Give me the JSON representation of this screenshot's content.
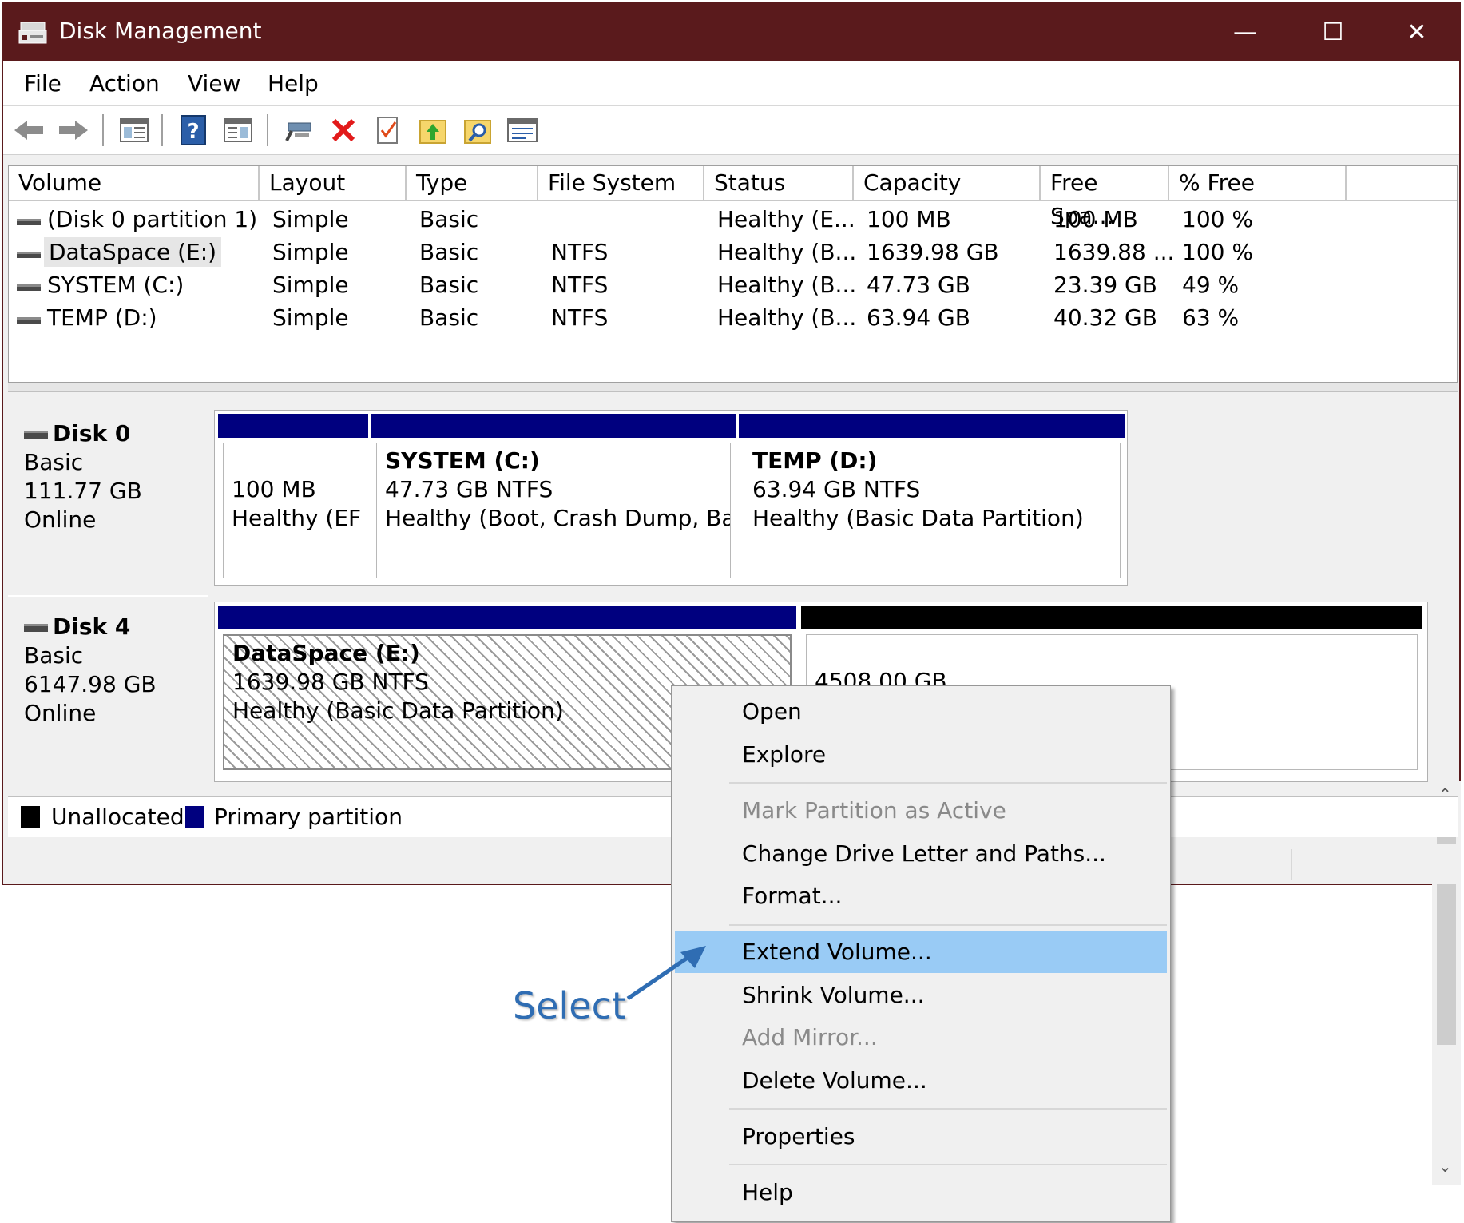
{
  "window": {
    "title": "Disk Management",
    "controls": {
      "minimize": "—",
      "maximize": "☐",
      "close": "✕"
    }
  },
  "menubar": [
    "File",
    "Action",
    "View",
    "Help"
  ],
  "toolbar": [
    "back-icon",
    "forward-icon",
    "console-tree-icon",
    "help-icon",
    "action-pane-icon",
    "connect-icon",
    "delete-icon",
    "check-icon",
    "up-folder-icon",
    "search-folder-icon",
    "properties-icon"
  ],
  "columns": [
    "Volume",
    "Layout",
    "Type",
    "File System",
    "Status",
    "Capacity",
    "Free Spa...",
    "% Free"
  ],
  "volumes": [
    {
      "volume": "(Disk 0 partition 1)",
      "layout": "Simple",
      "type": "Basic",
      "fs": "",
      "status": "Healthy (E...",
      "capacity": "100 MB",
      "free": "100 MB",
      "pct": "100 %"
    },
    {
      "volume": "DataSpace (E:)",
      "layout": "Simple",
      "type": "Basic",
      "fs": "NTFS",
      "status": "Healthy (B...",
      "capacity": "1639.98 GB",
      "free": "1639.88 ...",
      "pct": "100 %"
    },
    {
      "volume": "SYSTEM (C:)",
      "layout": "Simple",
      "type": "Basic",
      "fs": "NTFS",
      "status": "Healthy (B...",
      "capacity": "47.73 GB",
      "free": "23.39 GB",
      "pct": "49 %"
    },
    {
      "volume": "TEMP (D:)",
      "layout": "Simple",
      "type": "Basic",
      "fs": "NTFS",
      "status": "Healthy (B...",
      "capacity": "63.94 GB",
      "free": "40.32 GB",
      "pct": "63 %"
    }
  ],
  "disks": [
    {
      "name": "Disk 0",
      "kind": "Basic",
      "size": "111.77 GB",
      "state": "Online",
      "partitions": [
        {
          "title": "",
          "line1": "100 MB",
          "line2": "Healthy (EFI"
        },
        {
          "title": "SYSTEM  (C:)",
          "line1": "47.73 GB NTFS",
          "line2": "Healthy (Boot, Crash Dump, Basi"
        },
        {
          "title": "TEMP  (D:)",
          "line1": "63.94 GB NTFS",
          "line2": "Healthy (Basic Data Partition)"
        }
      ]
    },
    {
      "name": "Disk 4",
      "kind": "Basic",
      "size": "6147.98 GB",
      "state": "Online",
      "partitions": [
        {
          "title": "DataSpace  (E:)",
          "line1": "1639.98 GB NTFS",
          "line2": "Healthy (Basic Data Partition)"
        },
        {
          "title": "",
          "line1": "4508.00 GB",
          "line2": ""
        }
      ]
    }
  ],
  "legend": {
    "unallocated": "Unallocated",
    "primary": "Primary partition"
  },
  "colors": {
    "titlebar": "#5a1a1c",
    "primary": "#00007f",
    "unallocated": "#000000",
    "highlight": "#99cbf5",
    "annotation": "#2f6db3"
  },
  "context_menu": {
    "items": [
      {
        "label": "Open",
        "enabled": true
      },
      {
        "label": "Explore",
        "enabled": true
      },
      {
        "label": "Mark Partition as Active",
        "enabled": false
      },
      {
        "label": "Change Drive Letter and Paths...",
        "enabled": true
      },
      {
        "label": "Format...",
        "enabled": true
      },
      {
        "label": "Extend Volume...",
        "enabled": true,
        "highlighted": true
      },
      {
        "label": "Shrink Volume...",
        "enabled": true
      },
      {
        "label": "Add Mirror...",
        "enabled": false
      },
      {
        "label": "Delete Volume...",
        "enabled": true
      },
      {
        "label": "Properties",
        "enabled": true
      },
      {
        "label": "Help",
        "enabled": true
      }
    ]
  },
  "annotation": "Select"
}
